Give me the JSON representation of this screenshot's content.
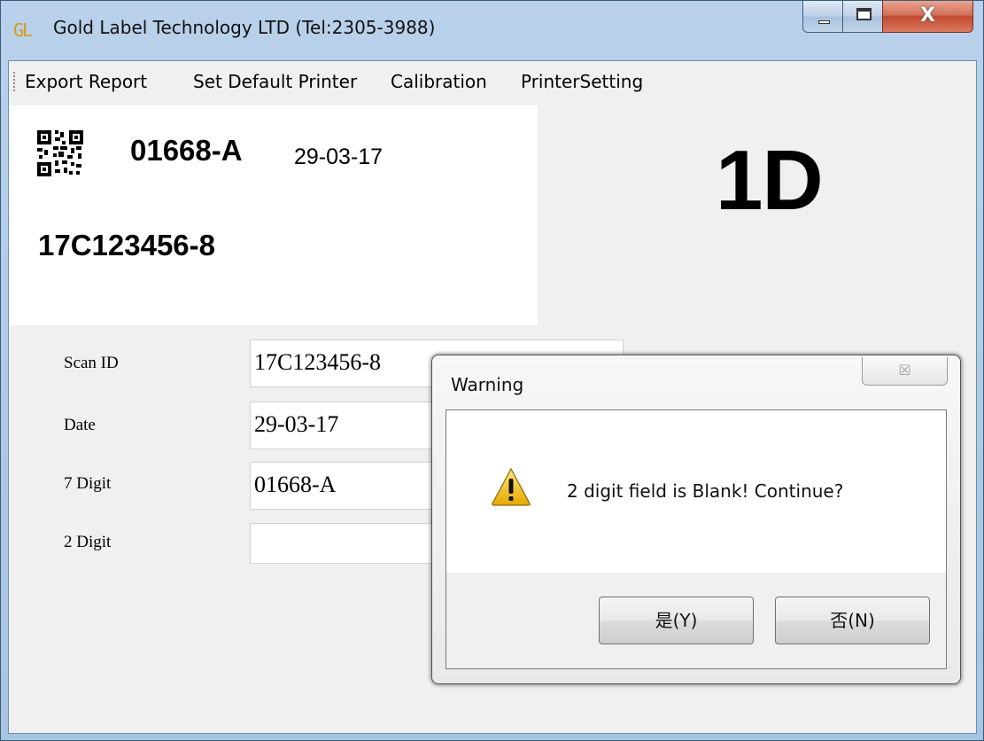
{
  "window": {
    "logo_text": "GL",
    "title": "Gold Label Technology LTD (Tel:2305-3988)",
    "close_glyph": "X"
  },
  "menu": {
    "items": [
      "Export Report",
      "Set Default Printer",
      "Calibration",
      "PrinterSetting"
    ]
  },
  "label_preview": {
    "qr_icon": "qr-code-icon",
    "code": "01668-A",
    "date": "29-03-17",
    "id": "17C123456-8"
  },
  "big_code": "1D",
  "form": {
    "scan_id": {
      "label": "Scan ID",
      "value": "17C123456-8"
    },
    "date": {
      "label": "Date",
      "value": "29-03-17"
    },
    "seven_digit": {
      "label": "7 Digit",
      "value": "01668-A"
    },
    "two_digit": {
      "label": "2 Digit",
      "value": ""
    }
  },
  "dialog": {
    "title": "Warning",
    "close_glyph": "☒",
    "icon": "warning-icon",
    "message": "2 digit field is Blank! Continue?",
    "yes_label": "是(Y)",
    "no_label": "否(N)"
  },
  "colors": {
    "title_bar": "#b9d1ea",
    "warning_yellow": "#f2c31a",
    "logo": "#d99a19"
  }
}
